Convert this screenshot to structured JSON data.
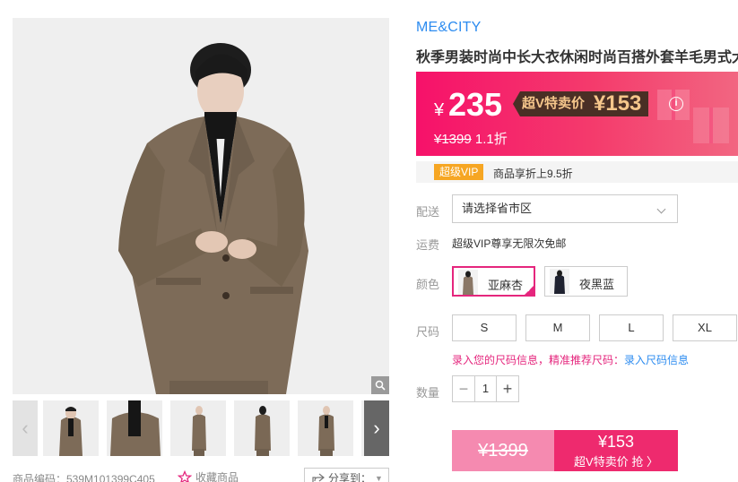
{
  "gallery": {
    "zoom_icon": "magnifier-icon",
    "prev_icon": "chevron-left-icon",
    "next_icon": "chevron-right-icon",
    "thumb_count": 6
  },
  "meta": {
    "code_label": "商品编码：539M101399C405",
    "fav_label": "收藏商品",
    "share_label": "分享到："
  },
  "product": {
    "brand": "ME&CITY",
    "title": "秋季男装时尚中长大衣休闲时尚百搭外套羊毛男式大"
  },
  "price": {
    "currency": "¥",
    "current": "235",
    "vip_label": "超V特卖价",
    "vip_price": "¥153",
    "info_icon": "i",
    "original": "¥1399",
    "discount": "1.1折"
  },
  "vip_bar": {
    "badge": "超级VIP",
    "text": "商品享折上9.5折"
  },
  "delivery": {
    "label": "配送",
    "region_placeholder": "请选择省市区"
  },
  "shipping": {
    "label": "运费",
    "text": "超级VIP尊享无限次免邮"
  },
  "colors": {
    "label": "颜色",
    "options": [
      {
        "name": "亚麻杏",
        "selected": true,
        "swatch": "#8a7766"
      },
      {
        "name": "夜黑蓝",
        "selected": false,
        "swatch": "#1f2230"
      }
    ]
  },
  "sizes": {
    "label": "尺码",
    "options": [
      "S",
      "M",
      "L",
      "XL"
    ],
    "hint": "录入您的尺码信息，精准推荐尺码：",
    "hint_link": "录入尺码信息"
  },
  "quantity": {
    "label": "数量",
    "value": "1",
    "minus": "−",
    "plus": "+"
  },
  "buy": {
    "original": "¥1399",
    "price": "¥153",
    "action": "超V特卖价 抢 〉"
  },
  "colors_theme": {
    "accent": "#e5267d",
    "link": "#2d8cf0",
    "price_red": "#f6116a"
  }
}
